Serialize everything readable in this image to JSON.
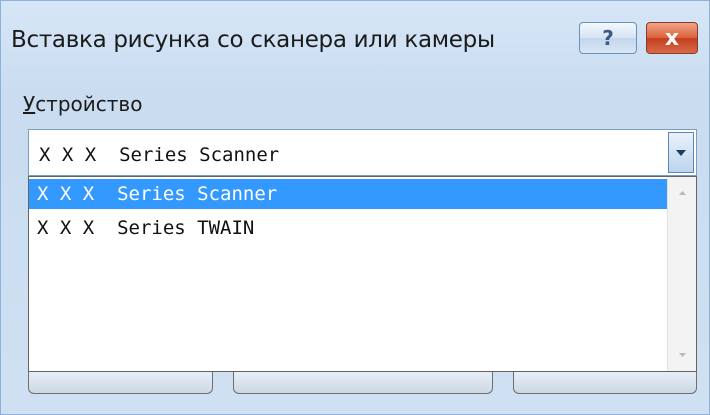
{
  "dialog": {
    "title": "Вставка рисунка со сканера или камеры",
    "help_glyph": "?",
    "close_glyph": "x"
  },
  "device": {
    "label_first_letter": "У",
    "label_rest": "стройство",
    "selected_value": "X X X  Series Scanner",
    "options": [
      {
        "label": "X X X  Series Scanner",
        "selected": true
      },
      {
        "label": "X X X  Series TWAIN",
        "selected": false
      }
    ]
  },
  "icons": {
    "dropdown_arrow": "chevron-down-icon",
    "scroll_up": "scroll-up-arrow-icon",
    "scroll_down": "scroll-down-arrow-icon"
  },
  "colors": {
    "selection": "#3399ff",
    "close_button": "#c3401d",
    "titlebar": "#d6e6f7"
  }
}
